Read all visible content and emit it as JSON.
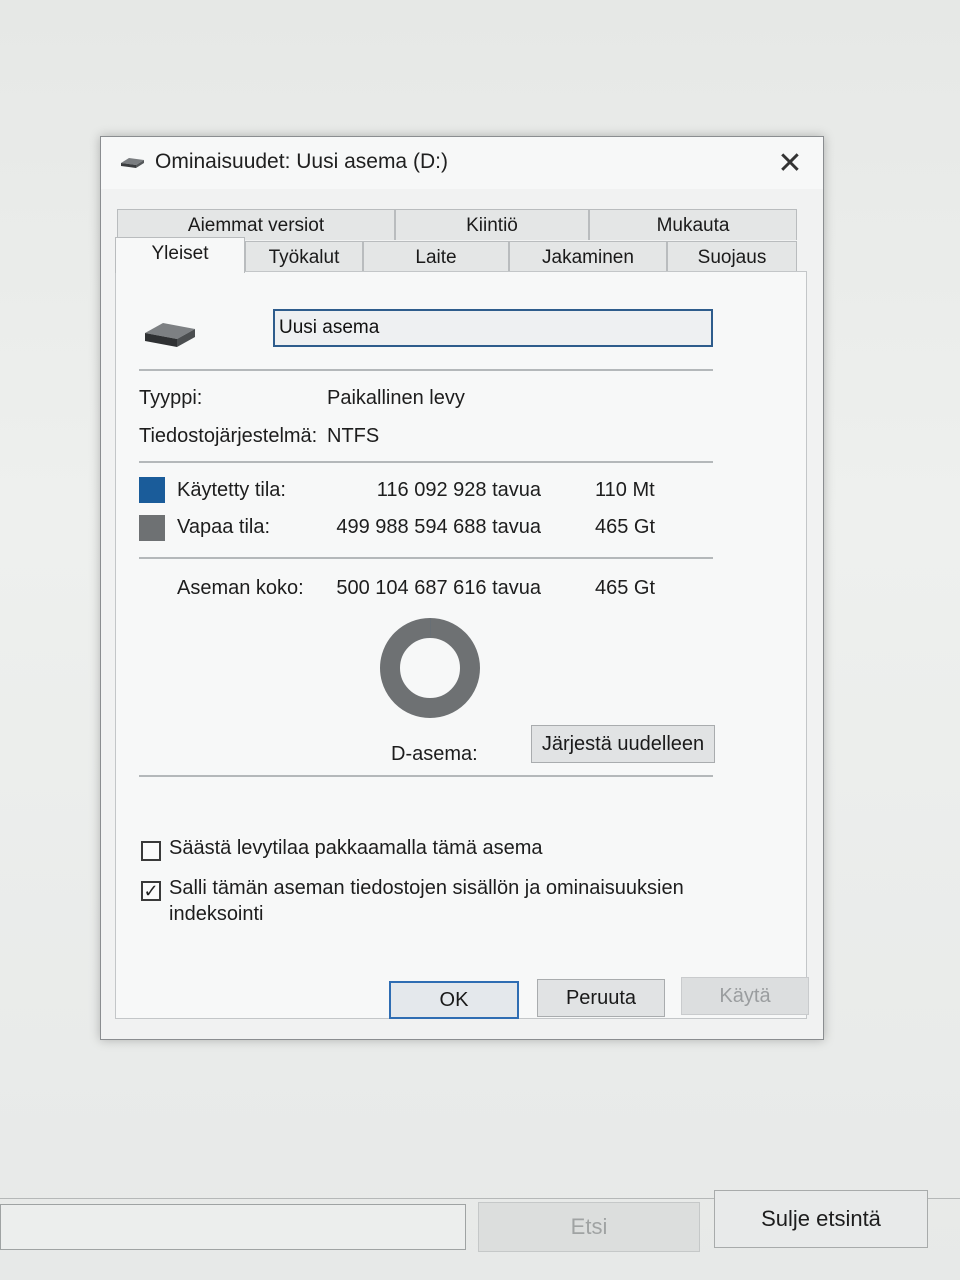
{
  "dialog": {
    "title": "Ominaisuudet: Uusi asema (D:)",
    "close_glyph": "✕"
  },
  "tabs": {
    "row_back": [
      "Aiemmat versiot",
      "Kiintiö",
      "Mukauta"
    ],
    "row_front": [
      "Yleiset",
      "Työkalut",
      "Laite",
      "Jakaminen",
      "Suojaus"
    ],
    "active": "Yleiset"
  },
  "general": {
    "drive_name_value": "Uusi asema",
    "type_label": "Tyyppi:",
    "type_value": "Paikallinen levy",
    "fs_label": "Tiedostojärjestelmä:",
    "fs_value": "NTFS",
    "used_label": "Käytetty tila:",
    "used_bytes": "116 092 928 tavua",
    "used_size": "110 Mt",
    "free_label": "Vapaa tila:",
    "free_bytes": "499 988 594 688 tavua",
    "free_size": "465 Gt",
    "capacity_label": "Aseman koko:",
    "capacity_bytes": "500 104 687 616 tavua",
    "capacity_size": "465 Gt",
    "drive_label": "D-asema:",
    "defrag_button": "Järjestä uudelleen",
    "used_fraction": 0.00023,
    "used_color": "#1a5c9a",
    "free_color": "#6e7173"
  },
  "options": {
    "compress_label": "Säästä levytilaa pakkaamalla tämä asema",
    "compress_checked": false,
    "index_label_line1": "Salli tämän aseman tiedostojen sisällön ja ominaisuuksien",
    "index_label_line2": "indeksointi",
    "index_checked": true,
    "check_glyph": "✓"
  },
  "buttons": {
    "ok": "OK",
    "cancel": "Peruuta",
    "apply": "Käytä"
  },
  "background": {
    "search_button": "Etsi",
    "close_search_button": "Sulje etsintä"
  }
}
